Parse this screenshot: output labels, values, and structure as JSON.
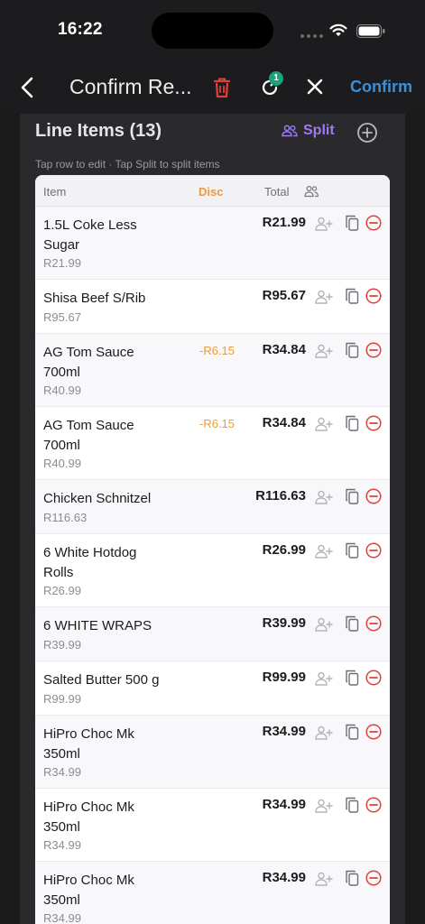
{
  "status_bar": {
    "time": "16:22"
  },
  "nav": {
    "title": "Confirm Re...",
    "badge_count": "1",
    "confirm_label": "Confirm"
  },
  "section": {
    "title": "Line Items (13)",
    "split_label": "Split",
    "hint": "Tap row to edit  ·  Tap Split to split items"
  },
  "table": {
    "headers": {
      "item": "Item",
      "disc": "Disc",
      "total": "Total"
    },
    "rows": [
      {
        "name": "1.5L Coke Less Sugar",
        "unit_price": "R21.99",
        "discount": "",
        "total": "R21.99"
      },
      {
        "name": "Shisa Beef S/Rib",
        "unit_price": "R95.67",
        "discount": "",
        "total": "R95.67"
      },
      {
        "name": "AG Tom Sauce 700ml",
        "unit_price": "R40.99",
        "discount": "-R6.15",
        "total": "R34.84"
      },
      {
        "name": "AG Tom Sauce 700ml",
        "unit_price": "R40.99",
        "discount": "-R6.15",
        "total": "R34.84"
      },
      {
        "name": "Chicken Schnitzel",
        "unit_price": "R116.63",
        "discount": "",
        "total": "R116.63"
      },
      {
        "name": "6 White Hotdog Rolls",
        "unit_price": "R26.99",
        "discount": "",
        "total": "R26.99"
      },
      {
        "name": "6 WHITE WRAPS",
        "unit_price": "R39.99",
        "discount": "",
        "total": "R39.99"
      },
      {
        "name": "Salted Butter 500 g",
        "unit_price": "R99.99",
        "discount": "",
        "total": "R99.99"
      },
      {
        "name": "HiPro Choc Mk 350ml",
        "unit_price": "R34.99",
        "discount": "",
        "total": "R34.99"
      },
      {
        "name": "HiPro Choc Mk 350ml",
        "unit_price": "R34.99",
        "discount": "",
        "total": "R34.99"
      },
      {
        "name": "HiPro Choc Mk 350ml",
        "unit_price": "R34.99",
        "discount": "",
        "total": "R34.99"
      }
    ]
  },
  "colors": {
    "confirm": "#3d8fd9",
    "trash": "#e0403a",
    "badge": "#1aa37a",
    "split": "#9d7af5",
    "discount": "#ee9a3c",
    "remove": "#e0403a"
  },
  "icons": [
    "back-chevron-icon",
    "trash-icon",
    "refresh-icon",
    "close-icon",
    "split-people-icon",
    "add-circle-icon",
    "people-icon",
    "assign-person-icon",
    "copy-icon",
    "remove-circle-icon"
  ]
}
